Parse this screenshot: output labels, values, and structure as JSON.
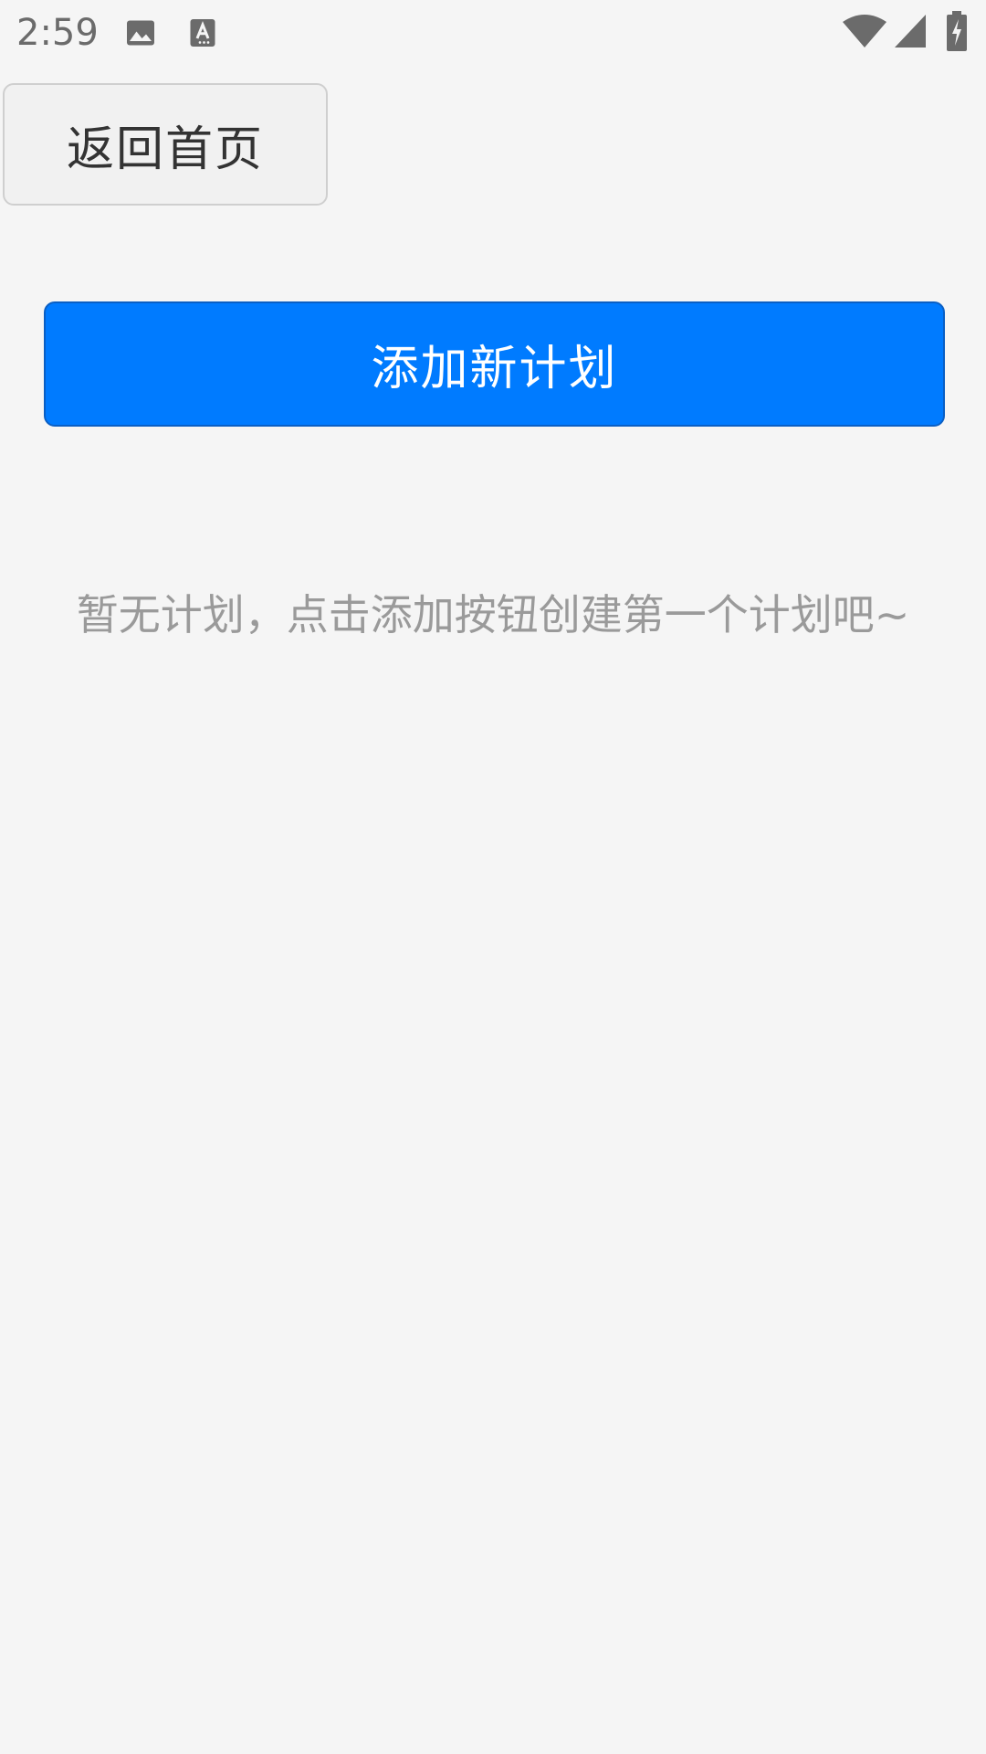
{
  "status_bar": {
    "time": "2:59",
    "icons": [
      "image-icon",
      "text-format-icon",
      "wifi-icon",
      "cell-signal-icon",
      "battery-charging-icon"
    ]
  },
  "header": {
    "back_label": "返回首页"
  },
  "main": {
    "add_label": "添加新计划",
    "empty_message": "暂无计划，点击添加按钮创建第一个计划吧~"
  },
  "colors": {
    "background": "#f5f5f5",
    "primary": "#007bff",
    "muted_text": "#9a9a9a",
    "status_icons": "#6b6b6b"
  }
}
